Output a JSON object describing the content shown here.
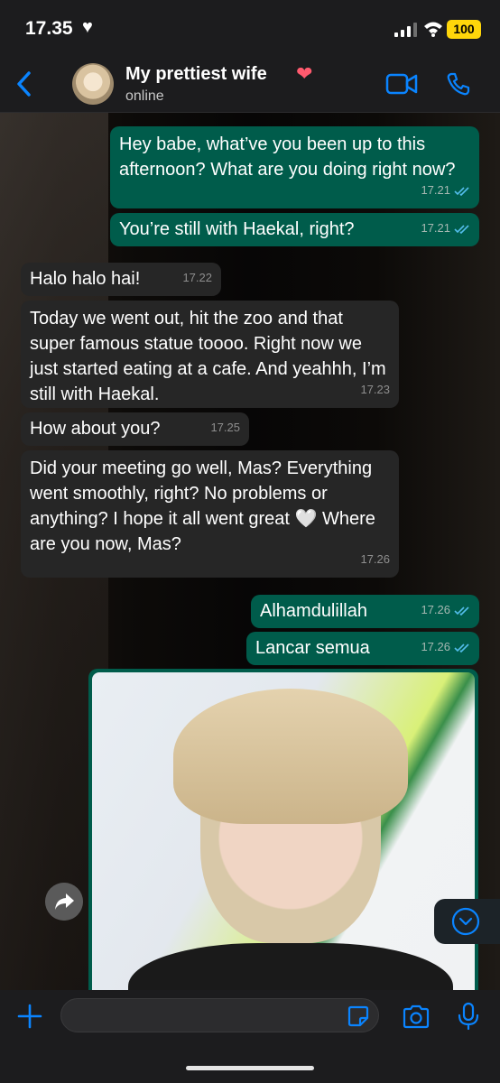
{
  "status_bar": {
    "time": "17.35",
    "time_icon": "heart-icon",
    "battery": "100"
  },
  "header": {
    "title": "My prettiest wife",
    "title_icon": "mending-heart-icon",
    "status": "online"
  },
  "messages": [
    {
      "direction": "out",
      "text": "Hey babe, what’ve you been up to this afternoon? What are you doing right now?",
      "time": "17.21",
      "read": true
    },
    {
      "direction": "out",
      "text": "You’re still with Haekal, right?",
      "time": "17.21",
      "read": true
    },
    {
      "direction": "in",
      "text": "Halo halo hai!",
      "time": "17.22"
    },
    {
      "direction": "in",
      "text": "Today we went out, hit the zoo and that super famous statue toooo. Right now we just started eating at a cafe. And yeahhh, I’m still with Haekal.",
      "time": "17.23"
    },
    {
      "direction": "in",
      "text": "How about you?",
      "time": "17.25"
    },
    {
      "direction": "in",
      "text": "Did your meeting go well, Mas? Everything went smoothly, right? No problems or anything? I hope it all went great 🤍 Where are you now, Mas?",
      "time": "17.26"
    },
    {
      "direction": "out",
      "text": "Alhamdulillah",
      "time": "17.26",
      "read": true
    },
    {
      "direction": "out",
      "text": "Lancar semua",
      "time": "17.26",
      "read": true
    }
  ],
  "composer": {
    "placeholder": "",
    "value": ""
  },
  "colors": {
    "outgoing": "#005c4b",
    "incoming": "#262626",
    "accent": "#0a84ff",
    "battery": "#ffd60a"
  }
}
